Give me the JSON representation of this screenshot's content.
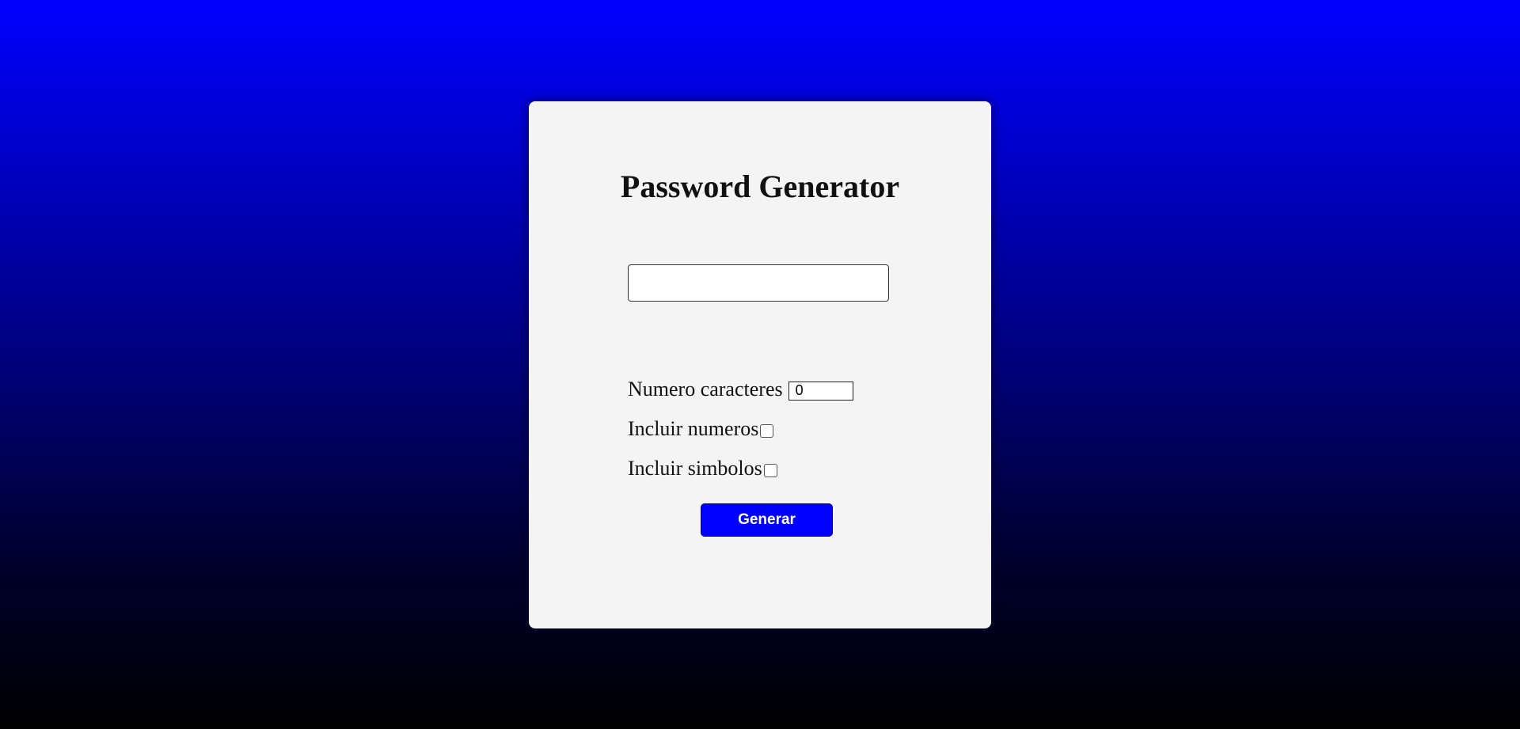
{
  "colors": {
    "background_top": "#0000ff",
    "background_bottom": "#000000",
    "card": "#f4f4f4",
    "button": "#0000ff",
    "button_text": "#ffffff"
  },
  "generator": {
    "title": "Password Generator",
    "password_value": "",
    "length_label": "Numero caracteres",
    "length_value": "0",
    "numbers_label": "Incluir numeros",
    "numbers_checked": false,
    "symbols_label": "Incluir simbolos",
    "symbols_checked": false,
    "generate_label": "Generar"
  }
}
